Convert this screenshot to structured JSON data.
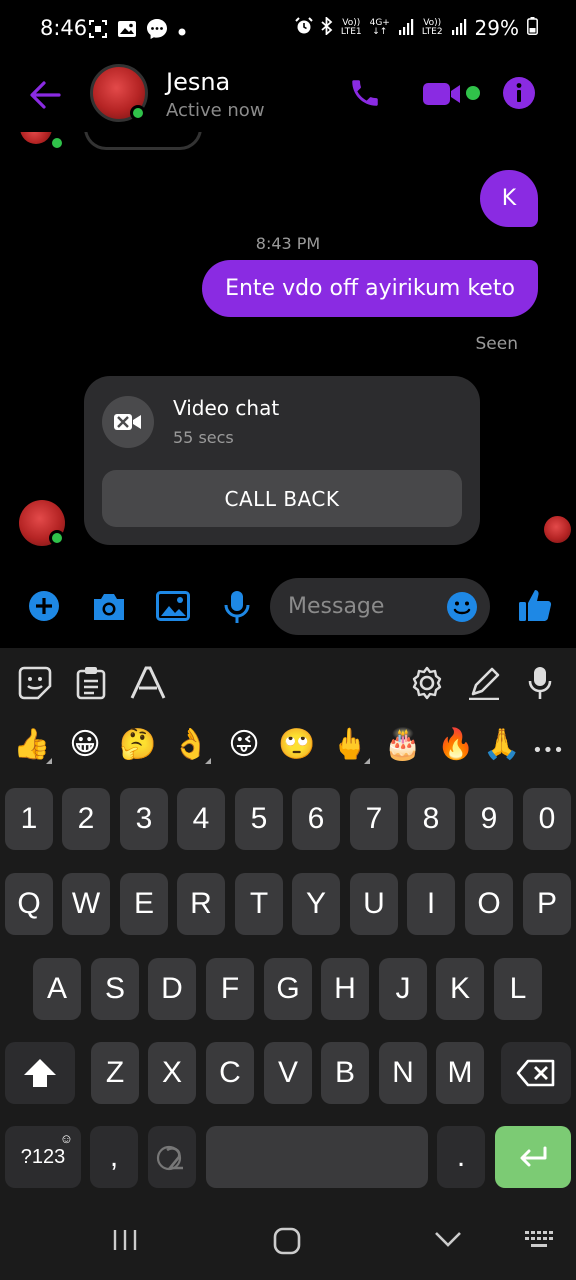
{
  "status_bar": {
    "time": "8:46",
    "left_icons": [
      "screenshot-icon",
      "gallery-icon",
      "messenger-notification-icon",
      "dot-icon"
    ],
    "right_icons": [
      "alarm-icon",
      "bluetooth-icon",
      "volte-lte1-icon",
      "4g-data-icon",
      "signal-icon",
      "volte-lte2-icon",
      "signal-icon",
      "battery-icon"
    ],
    "volte1": "Vo))",
    "lte1": "LTE1",
    "net": "4G+",
    "volte2": "Vo))",
    "lte2": "LTE2",
    "battery": "29%"
  },
  "header": {
    "contact_name": "Jesna",
    "contact_status": "Active now",
    "accent": "#8a2be2"
  },
  "chat": {
    "messages": [
      {
        "side": "sent",
        "text": "K"
      },
      {
        "side": "sent",
        "text": "Ente vdo off ayirikum keto"
      }
    ],
    "timestamp": "8:43 PM",
    "seen_label": "Seen",
    "call": {
      "title": "Video chat",
      "duration": "55 secs",
      "button_label": "CALL BACK"
    }
  },
  "composer": {
    "placeholder": "Message"
  },
  "keyboard": {
    "emojis": [
      "👍",
      "😀",
      "🤔",
      "👌",
      "😜",
      "🙄",
      "🖕",
      "🎂",
      "🔥",
      "🙏"
    ],
    "more_label": "•••",
    "row_numbers": [
      "1",
      "2",
      "3",
      "4",
      "5",
      "6",
      "7",
      "8",
      "9",
      "0"
    ],
    "row_top": [
      "Q",
      "W",
      "E",
      "R",
      "T",
      "Y",
      "U",
      "I",
      "O",
      "P"
    ],
    "row_middle": [
      "A",
      "S",
      "D",
      "F",
      "G",
      "H",
      "J",
      "K",
      "L"
    ],
    "row_bottom": [
      "Z",
      "X",
      "C",
      "V",
      "B",
      "N",
      "M"
    ],
    "symbols_label": "?123",
    "comma_label": ",",
    "period_label": ".",
    "enter_color": "#7ccb74"
  }
}
